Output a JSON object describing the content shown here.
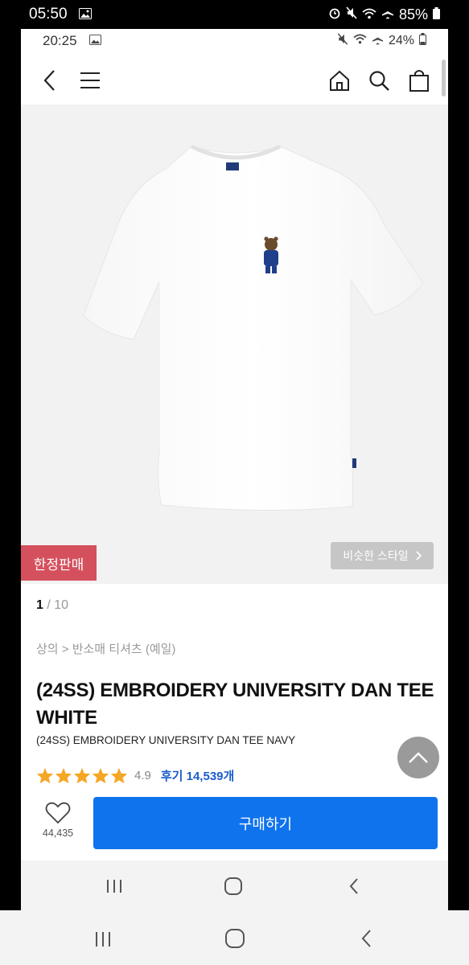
{
  "outer_status": {
    "time": "05:50",
    "battery": "85%"
  },
  "inner_status": {
    "time": "20:25",
    "battery": "24%"
  },
  "icons": {
    "back": "chevron-left-icon",
    "menu": "hamburger-menu-icon",
    "home": "home-icon",
    "search": "search-icon",
    "cart": "shopping-bag-icon",
    "heart": "heart-icon",
    "top": "arrow-up-icon"
  },
  "product": {
    "badge": "한정판매",
    "similar_style": "비슷한 스타일",
    "image_index": "1",
    "image_total": "10",
    "breadcrumb": "상의 > 반소매 티셔츠 (예일)",
    "title_line1": "(24SS) EMBROIDERY UNIVERSITY DAN TEE",
    "title_line2": "WHITE",
    "subtitle": "(24SS) EMBROIDERY UNIVERSITY DAN TEE NAVY",
    "rating": "4.9",
    "stars": 5,
    "reviews": "후기 14,539개"
  },
  "cta": {
    "likes": "44,435",
    "buy_label": "구매하기"
  },
  "colors": {
    "accent": "#0f73ee",
    "badge": "#d5505d",
    "star": "#f5a623"
  }
}
